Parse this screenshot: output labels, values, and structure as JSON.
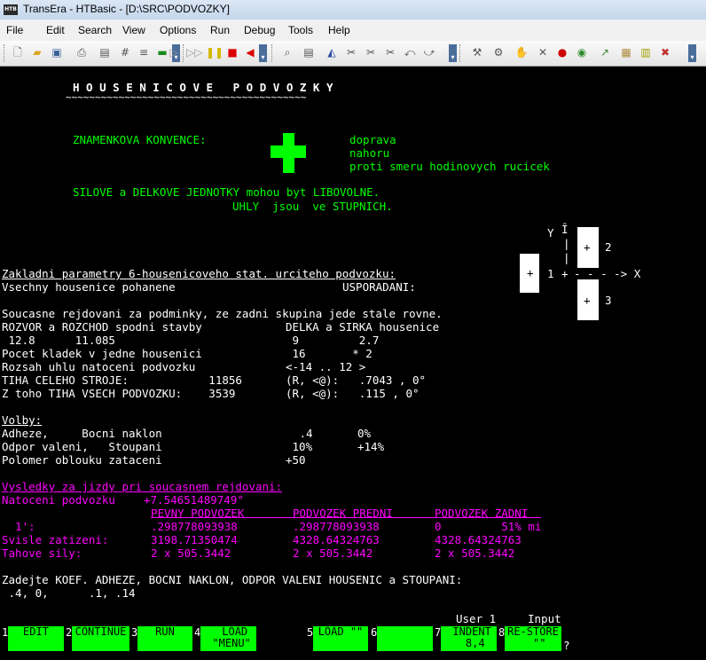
{
  "window": {
    "icon_text": "HTB",
    "title": "TransEra - HTBasic - [D:\\SRC\\PODVOZKY]"
  },
  "menu": [
    "File",
    "Edit",
    "Search",
    "View",
    "Options",
    "Run",
    "Debug",
    "Tools",
    "Help"
  ],
  "toolbar": {
    "icons": [
      "new-document-icon",
      "open-folder-icon",
      "save-icon",
      "print-icon",
      "print-preview-icon",
      "hash-icon",
      "list-icon",
      "monitor-icon",
      "run-icon",
      "step-icon",
      "continue-icon",
      "pause-icon",
      "stop-icon",
      "back-icon",
      "find-icon",
      "find-next-icon",
      "replace-icon",
      "scissors-icon",
      "copy-icon",
      "paste-icon",
      "undo-icon",
      "redo-icon",
      "tools-icon",
      "wrench-icon",
      "hand-icon",
      "delete-icon",
      "record-icon",
      "refresh-icon",
      "export-icon",
      "import-icon",
      "options-icon"
    ]
  },
  "colors": {
    "background": "#000000",
    "text": "#ffffff",
    "green": "#00ff00",
    "magenta": "#ff00ff",
    "softkey": "#00ff00"
  },
  "screen": {
    "heading": "H O U S E N I C O V E   P O D V O Z K Y",
    "heading_underline": "~~~~~~~~~~~~~~~~~~~~~~~~~~~~~~~~~~~~~~~~~",
    "sign_convention": {
      "label": "ZNAMENKOVA KONVENCE:",
      "items": [
        "doprava",
        "nahoru",
        "proti smeru hodinovych rucicek"
      ]
    },
    "units_line1": "SILOVE a DELKOVE JEDNOTKY mohou byt LIBOVOLNE.",
    "units_line2": "UHLY  jsou  ve STUPNICH.",
    "diagram": {
      "y_label": "Y",
      "y_arrow": "Î",
      "x_arrow": "- - - -> X",
      "plus": "+",
      "tracks": [
        "1",
        "2",
        "3"
      ]
    },
    "params_title": "Zakladni parametry 6-housenicoveho stat. urciteho podvozku:",
    "params": [
      {
        "label": "Vsechny housenice pohanene",
        "value": "USPORADANI:"
      },
      {
        "label": "Soucasne rejdovani za podminky, ze zadni skupina jede stale rovne.",
        "value": ""
      },
      {
        "label": "ROZVOR a ROZCHOD spodni stavby",
        "value": "DELKA a SIRKA housenice"
      },
      {
        "label": " 12.8      11.085",
        "value": " 9         2.7"
      },
      {
        "label": "Pocet kladek v jedne housenici",
        "value": " 16       * 2"
      },
      {
        "label": "Rozsah uhlu natoceni podvozku",
        "value": "<-14 .. 12 >"
      },
      {
        "label": "TIHA CELEHO STROJE:            11856",
        "value": "(R, <@):   .7043 , 0°"
      },
      {
        "label": "Z toho TIHA VSECH PODVOZKU:    3539",
        "value": "(R, <@):   .115 , 0°"
      }
    ],
    "options_title": "Volby:",
    "options": [
      {
        "label": "Adheze,     Bocni naklon",
        "v1": " .4",
        "v2": "0%"
      },
      {
        "label": "Odpor valeni,   Stoupani",
        "v1": " 10%",
        "v2": "+14%"
      },
      {
        "label": "Polomer oblouku zataceni",
        "v1": "+50",
        "v2": ""
      }
    ],
    "results_title": "Vysledky za jizdy pri soucasnem rejdovani:",
    "rotation": {
      "label": "Natoceni podvozku",
      "value": "+7.54651489749°"
    },
    "results_headers": [
      "PEVNY PODVOZEK",
      "PODVOZEK PREDNI",
      "PODVOZEK ZADNI"
    ],
    "results_rows": [
      {
        "label": "  1':",
        "c1": ".298778093938",
        "c2": ".298778093938",
        "c3": "0         51% mi"
      },
      {
        "label": "Svisle zatizeni:",
        "c1": "3198.71350474",
        "c2": "4328.64324763",
        "c3": "4328.64324763"
      },
      {
        "label": "Tahove sily:",
        "c1": "2 x 505.3442",
        "c2": "2 x 505.3442",
        "c3": "2 x 505.3442"
      }
    ],
    "prompt": "Zadejte KOEF. ADHEZE, BOCNI NAKLON, ODPOR VALENI HOUSENIC a STOUPANI:",
    "input_value": " .4, 0,      .1, .14"
  },
  "status": {
    "user": "User 1",
    "mode": "Input"
  },
  "softkeys": [
    {
      "num": "1",
      "label": "EDIT"
    },
    {
      "num": "2",
      "label": "CONTINUE"
    },
    {
      "num": "3",
      "label": "RUN"
    },
    {
      "num": "4",
      "label": "  LOAD\n \"MENU\""
    },
    {
      "num": "5",
      "label": "LOAD \"\""
    },
    {
      "num": "6",
      "label": ""
    },
    {
      "num": "7",
      "label": " INDENT\n  8,4"
    },
    {
      "num": "8",
      "label": "RE-STORE\n  \"\""
    }
  ],
  "cursor_mark": "?"
}
